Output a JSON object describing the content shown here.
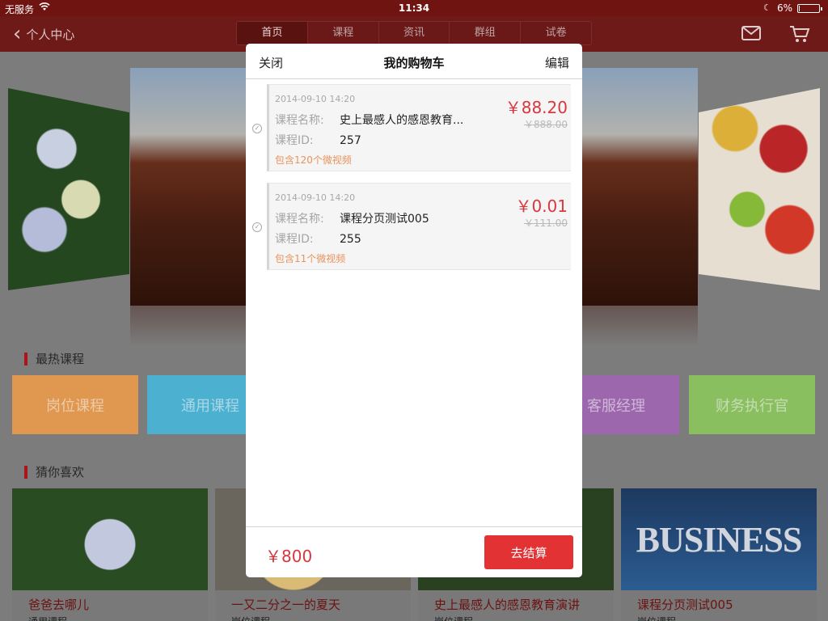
{
  "status_bar": {
    "carrier": "无服务",
    "time": "11:34",
    "battery_pct": "6%",
    "battery_level": 0.06
  },
  "nav": {
    "back_label": "个人中心",
    "tabs": [
      "首页",
      "课程",
      "资讯",
      "群组",
      "试卷"
    ],
    "active_tab": 0
  },
  "background": {
    "hot_courses_title": "最热课程",
    "categories": [
      {
        "label": "岗位课程",
        "color": "#e89c52"
      },
      {
        "label": "通用课程",
        "color": "#4fb7d8"
      },
      {
        "label": "客服经理",
        "color": "#a36bb3"
      },
      {
        "label": "财务执行官",
        "color": "#8fc664"
      }
    ],
    "recommend_title": "猜你喜欢",
    "recommendations": [
      {
        "name": "爸爸去哪儿",
        "sub": "通用课程"
      },
      {
        "name": "一又二分之一的夏天",
        "sub": "岗位课程"
      },
      {
        "name": "史上最感人的感恩教育演讲",
        "sub": "岗位课程"
      },
      {
        "name": "课程分页测试005",
        "sub": "岗位课程",
        "image_text": "BUSINESS"
      }
    ]
  },
  "cart": {
    "close_label": "关闭",
    "title": "我的购物车",
    "edit_label": "编辑",
    "items": [
      {
        "date": "2014-09-10 14:20",
        "name_label": "课程名称:",
        "name": "史上最感人的感恩教育...",
        "id_label": "课程ID:",
        "id": "257",
        "videos": "包含120个微视频",
        "price": "￥88.20",
        "original_price": "￥888.00"
      },
      {
        "date": "2014-09-10 14:20",
        "name_label": "课程名称:",
        "name": "课程分页测试005",
        "id_label": "课程ID:",
        "id": "255",
        "videos": "包含11个微视频",
        "price": "￥0.01",
        "original_price": "￥111.00"
      }
    ],
    "total": "￥800",
    "checkout_label": "去结算"
  }
}
